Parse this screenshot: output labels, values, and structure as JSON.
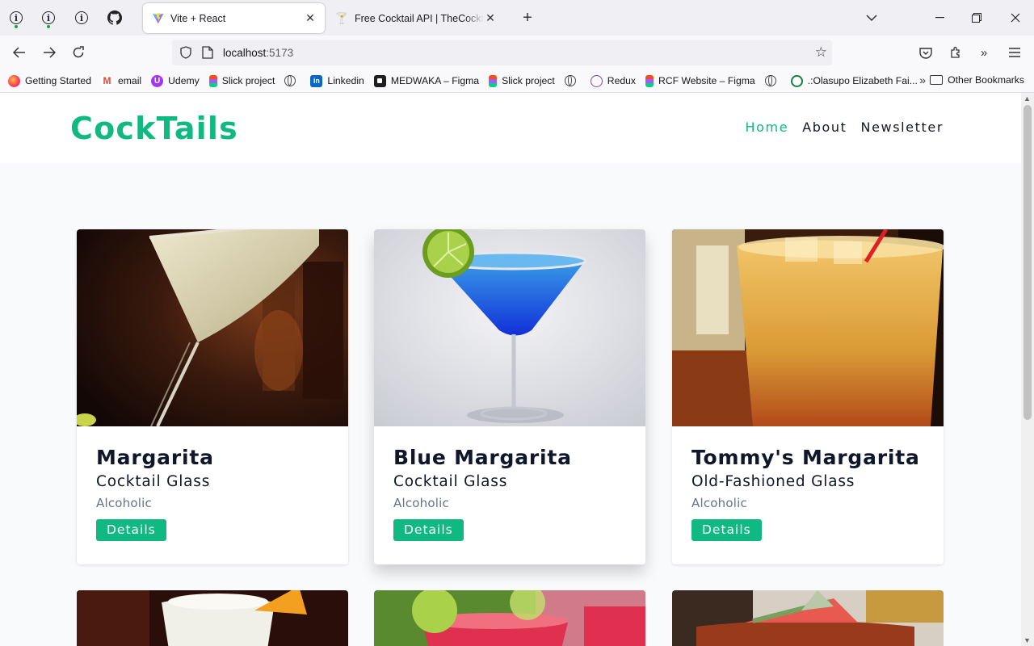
{
  "browser": {
    "tabs": [
      {
        "title": "Vite + React",
        "active": true
      },
      {
        "title": "Free Cocktail API | TheCocktailDB"
      }
    ],
    "url": {
      "host": "localhost",
      "port": ":5173"
    },
    "bookmarks": [
      {
        "label": "Getting Started"
      },
      {
        "label": "email"
      },
      {
        "label": "Udemy"
      },
      {
        "label": "Slick project"
      },
      {
        "label": ""
      },
      {
        "label": "Linkedin"
      },
      {
        "label": "MEDWAKA – Figma"
      },
      {
        "label": "Slick project"
      },
      {
        "label": ""
      },
      {
        "label": "Redux"
      },
      {
        "label": "RCF Website – Figma"
      },
      {
        "label": ""
      },
      {
        "label": ".:Olasupo Elizabeth Fai..."
      }
    ],
    "other_bookmarks": "Other Bookmarks"
  },
  "site": {
    "logo": "CockTails",
    "nav": [
      "Home",
      "About",
      "Newsletter"
    ],
    "active_nav": "Home"
  },
  "cards": [
    {
      "name": "Margarita",
      "glass": "Cocktail Glass",
      "info": "Alcoholic",
      "button": "Details"
    },
    {
      "name": "Blue Margarita",
      "glass": "Cocktail Glass",
      "info": "Alcoholic",
      "button": "Details"
    },
    {
      "name": "Tommy's Margarita",
      "glass": "Old-Fashioned Glass",
      "info": "Alcoholic",
      "button": "Details"
    }
  ]
}
